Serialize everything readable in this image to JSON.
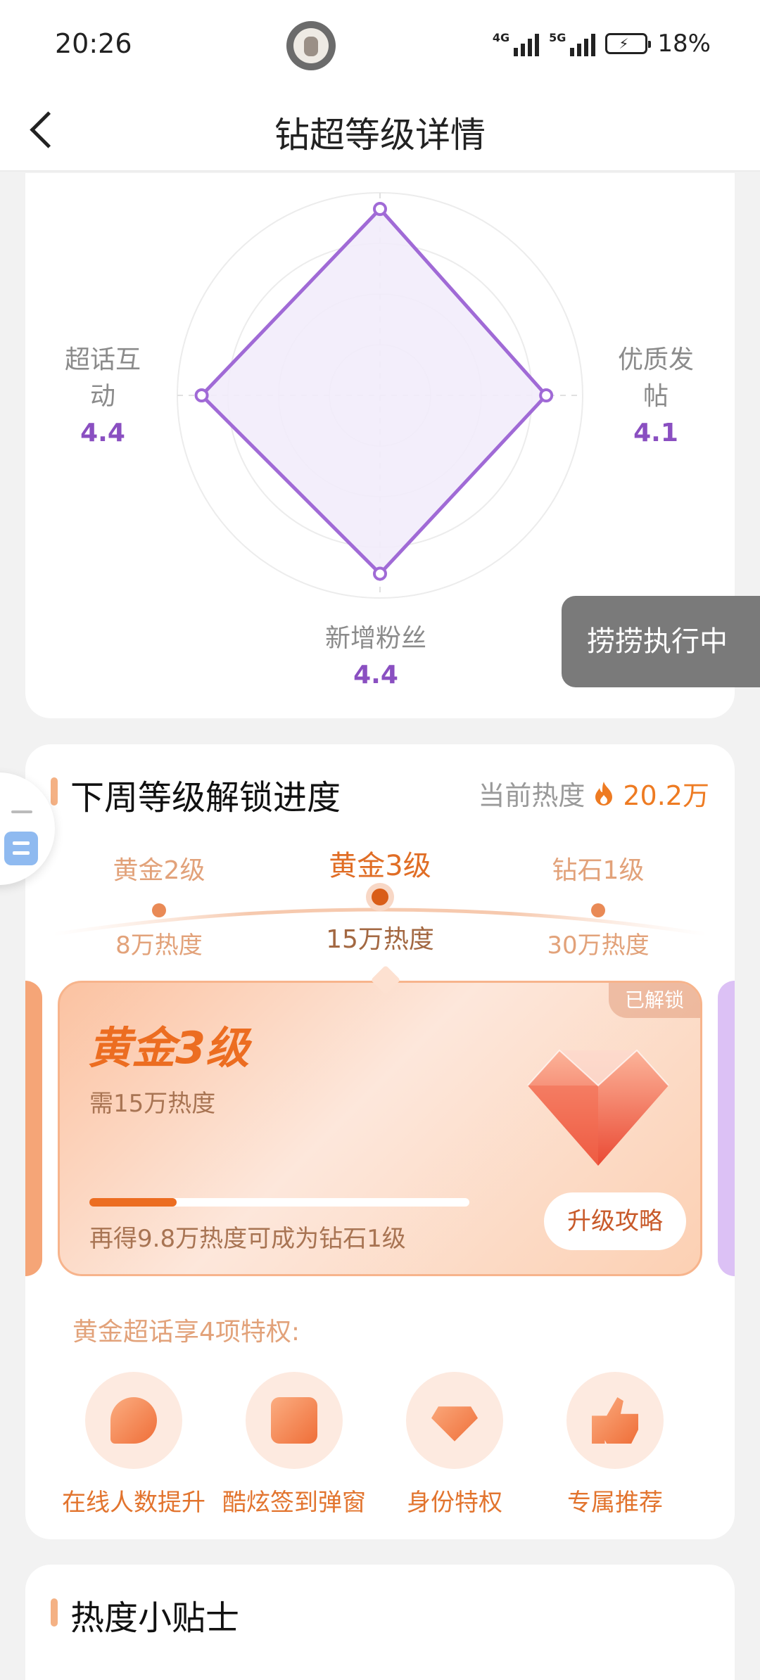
{
  "status_bar": {
    "time": "20:26",
    "signal_1": "4G",
    "signal_2": "5G",
    "battery": "18%"
  },
  "nav": {
    "title": "钻超等级详情"
  },
  "radar": {
    "dimensions": [
      {
        "name": "",
        "score": ""
      },
      {
        "name": "优质发帖",
        "score": "4.1"
      },
      {
        "name": "新增粉丝",
        "score": "4.4"
      },
      {
        "name": "超话互动",
        "score": "4.4"
      }
    ],
    "values": [
      4.6,
      4.1,
      4.4,
      4.4
    ],
    "max": 5,
    "colors": {
      "stroke": "#a06ad6",
      "fill": "#f2ecfb"
    }
  },
  "toast": {
    "text": "捞捞执行中"
  },
  "unlock": {
    "title": "下周等级解锁进度",
    "current_heat_label": "当前热度",
    "current_heat_value": "20.2万",
    "levels": [
      {
        "name": "黄金2级",
        "heat": "8万热度"
      },
      {
        "name": "黄金3级",
        "heat": "15万热度"
      },
      {
        "name": "钻石1级",
        "heat": "30万热度"
      }
    ],
    "card": {
      "level": "黄金3级",
      "requirement": "需15万热度",
      "status_tag": "已解锁",
      "progress": 0.23,
      "hint": "再得9.8万热度可成为钻石1级",
      "button": "升级攻略"
    },
    "privileges_title": "黄金超话享4项特权:",
    "privileges": [
      {
        "label": "在线人数提升",
        "icon": "face-icon"
      },
      {
        "label": "酷炫签到弹窗",
        "icon": "calendar-check-icon"
      },
      {
        "label": "身份特权",
        "icon": "diamond-icon"
      },
      {
        "label": "专属推荐",
        "icon": "thumbs-up-icon"
      }
    ],
    "colors": {
      "accent": "#ec6d21",
      "muted": "#e2a27a"
    }
  },
  "tips": {
    "title": "热度小贴士"
  }
}
